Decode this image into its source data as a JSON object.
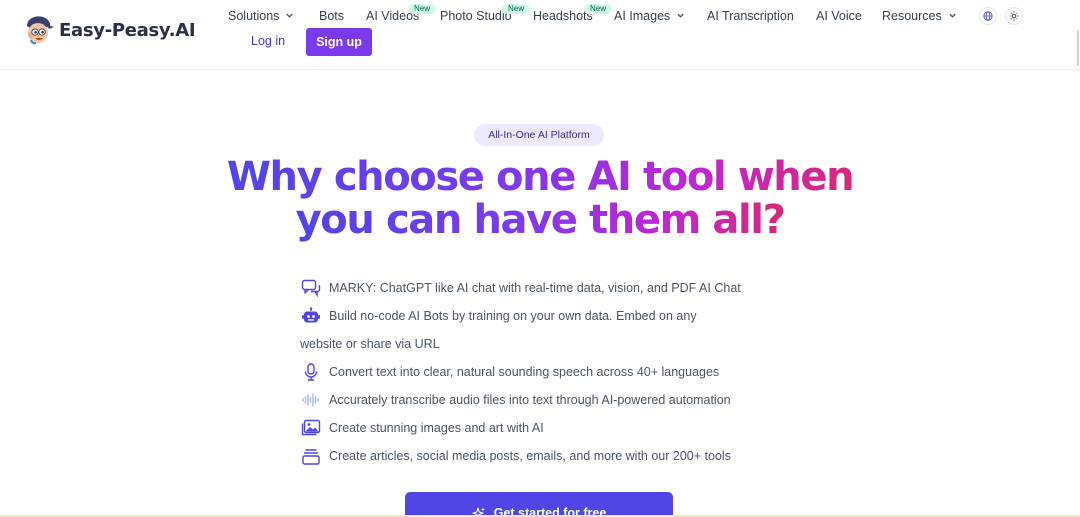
{
  "brand": {
    "name": "Easy-Peasy.AI"
  },
  "nav": {
    "items": [
      {
        "label": "Solutions",
        "dropdown": true,
        "new": false
      },
      {
        "label": "Bots",
        "dropdown": false,
        "new": false
      },
      {
        "label": "AI Videos",
        "dropdown": false,
        "new": true
      },
      {
        "label": "Photo Studio",
        "dropdown": false,
        "new": true
      },
      {
        "label": "Headshots",
        "dropdown": false,
        "new": true
      },
      {
        "label": "AI Images",
        "dropdown": true,
        "new": false
      },
      {
        "label": "AI Transcription",
        "dropdown": false,
        "new": false
      },
      {
        "label": "AI Voice",
        "dropdown": false,
        "new": false
      },
      {
        "label": "Resources",
        "dropdown": true,
        "new": false
      }
    ],
    "new_badge": "New",
    "language_icon": "globe-icon",
    "theme_icon": "sun-icon",
    "login_label": "Log in",
    "signup_label": "Sign up"
  },
  "hero": {
    "badge": "All-In-One AI Platform",
    "headline_line1": "Why choose one AI tool when",
    "headline_line2": "you can have them all?",
    "features": [
      {
        "icon": "chat-bubbles-icon",
        "text": "MARKY: ChatGPT like AI chat with real-time data, vision, and PDF AI Chat"
      },
      {
        "icon": "robot-icon",
        "text": "Build no-code AI Bots by training on your own data. Embed on any",
        "continuation": "website or share via URL"
      },
      {
        "icon": "microphone-icon",
        "text": "Convert text into clear, natural sounding speech across 40+ languages"
      },
      {
        "icon": "audio-waveform-icon",
        "text": "Accurately transcribe audio files into text through AI-powered automation"
      },
      {
        "icon": "image-gallery-icon",
        "text": "Create stunning images and art with AI"
      },
      {
        "icon": "document-stack-icon",
        "text": "Create articles, social media posts, emails, and more with our 200+ tools"
      }
    ],
    "cta_label": "Get started for free",
    "cta_icon": "sparkles-icon"
  },
  "colors": {
    "primary": "#4f46e5",
    "signup": "#7c3aed",
    "gradient_start": "#4f46e5",
    "gradient_end": "#db2777",
    "new_badge_bg": "#d1fae5"
  }
}
